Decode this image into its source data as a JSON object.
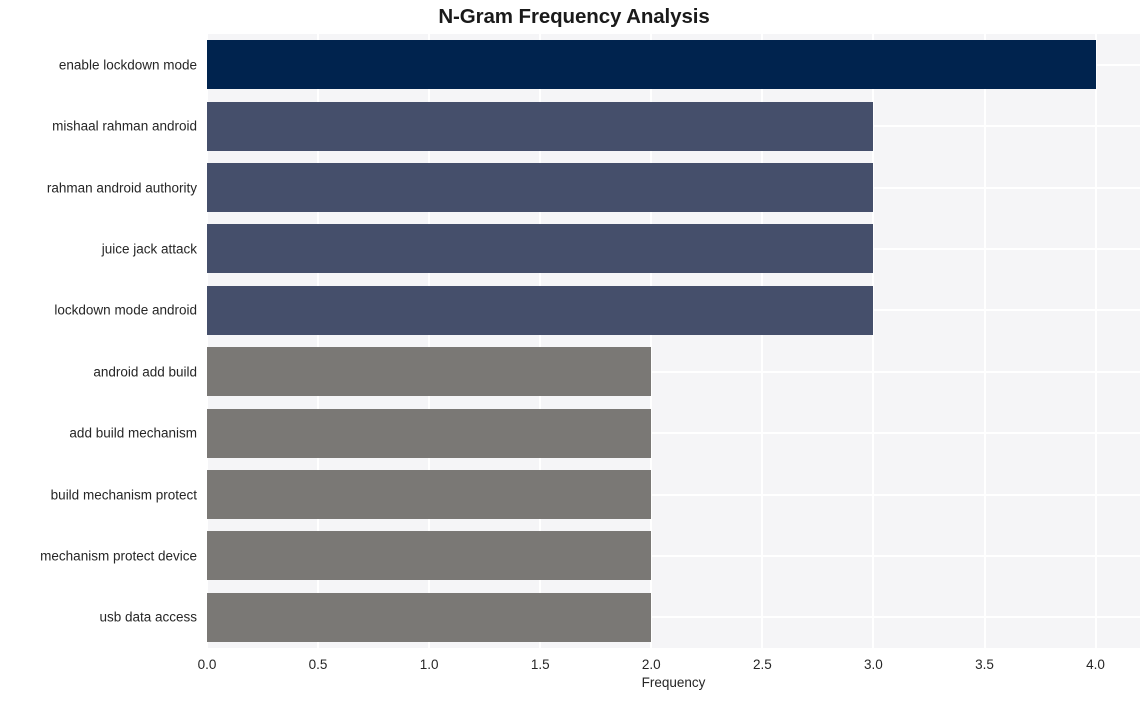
{
  "chart_data": {
    "type": "bar",
    "orientation": "horizontal",
    "title": "N-Gram Frequency Analysis",
    "xlabel": "Frequency",
    "ylabel": "",
    "xlim": [
      0.0,
      4.2
    ],
    "xticks": [
      "0.0",
      "0.5",
      "1.0",
      "1.5",
      "2.0",
      "2.5",
      "3.0",
      "3.5",
      "4.0"
    ],
    "xtick_values": [
      0.0,
      0.5,
      1.0,
      1.5,
      2.0,
      2.5,
      3.0,
      3.5,
      4.0
    ],
    "grid": true,
    "legend": "none",
    "categories": [
      "enable lockdown mode",
      "mishaal rahman android",
      "rahman android authority",
      "juice jack attack",
      "lockdown mode android",
      "android add build",
      "add build mechanism",
      "build mechanism protect",
      "mechanism protect device",
      "usb data access"
    ],
    "values": [
      4,
      3,
      3,
      3,
      3,
      2,
      2,
      2,
      2,
      2
    ],
    "bar_colors": [
      "#00234e",
      "#454f6b",
      "#454f6b",
      "#454f6b",
      "#454f6b",
      "#7a7875",
      "#7a7875",
      "#7a7875",
      "#7a7875",
      "#7a7875"
    ]
  },
  "style": {
    "plot_background": "#f5f5f7",
    "grid_color": "#ffffff",
    "figure_background": "#ffffff",
    "text_color": "#262626",
    "title_color": "#1a1a1a"
  }
}
